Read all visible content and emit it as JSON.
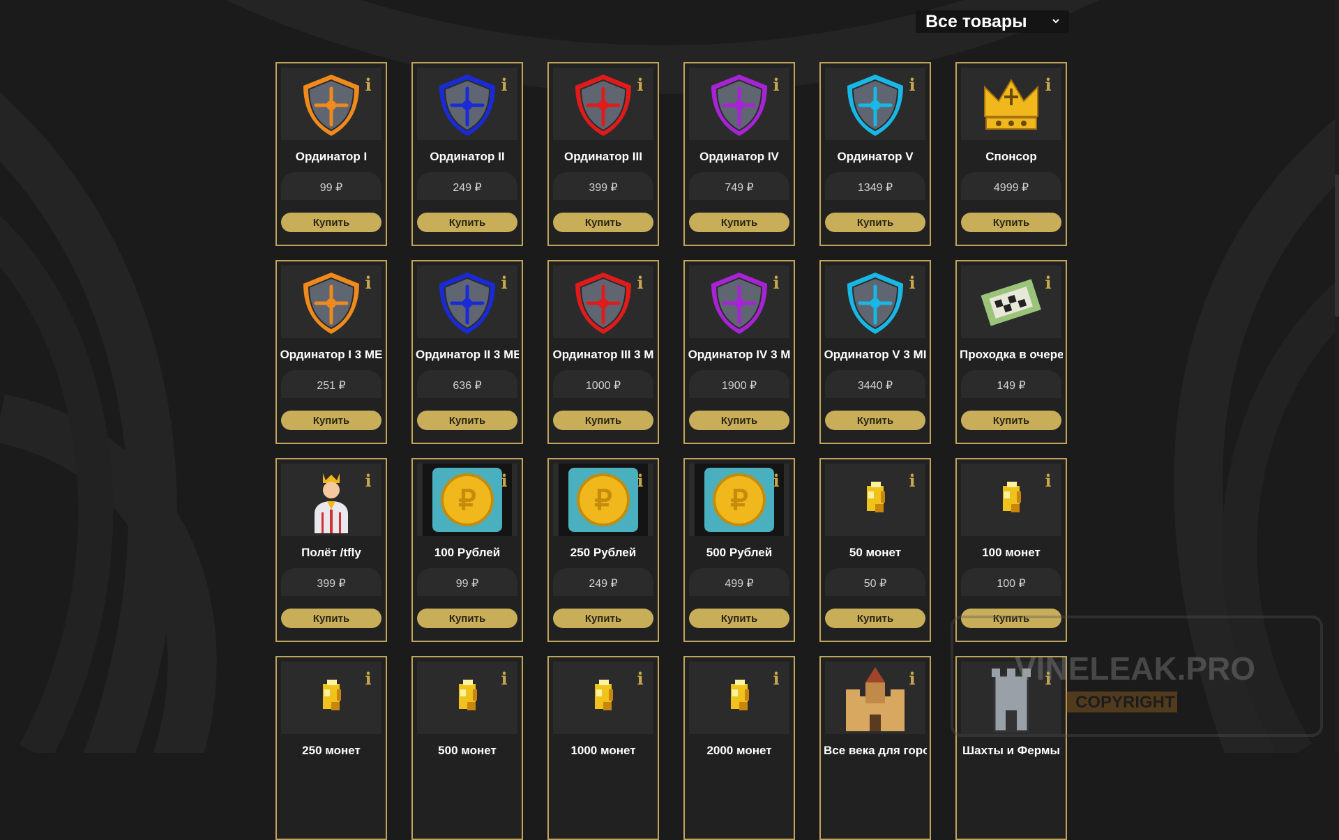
{
  "filter": {
    "selected": "Все товары"
  },
  "colors": {
    "accent": "#c9ae5a",
    "border": "#bfa45a",
    "background": "#1b1b1c",
    "card": "#212121"
  },
  "watermark": {
    "text": "VINELEAK.PRO",
    "subtext": "COPYRIGHT"
  },
  "products": [
    {
      "name": "Ординатор I",
      "price": "99 ₽",
      "buy": "Купить",
      "icon": "shield-orange-icon",
      "color": "#f08a1c"
    },
    {
      "name": "Ординатор II",
      "price": "249 ₽",
      "buy": "Купить",
      "icon": "shield-blue-icon",
      "color": "#1a2bd6"
    },
    {
      "name": "Ординатор III",
      "price": "399 ₽",
      "buy": "Купить",
      "icon": "shield-red-icon",
      "color": "#e01b1b"
    },
    {
      "name": "Ординатор IV",
      "price": "749 ₽",
      "buy": "Купить",
      "icon": "shield-purple-icon",
      "color": "#a624d4"
    },
    {
      "name": "Ординатор V",
      "price": "1349 ₽",
      "buy": "Купить",
      "icon": "shield-cyan-icon",
      "color": "#18b8e6"
    },
    {
      "name": "Спонсор",
      "price": "4999 ₽",
      "buy": "Купить",
      "icon": "crown-icon",
      "color": "#f0b81c"
    },
    {
      "name": "Ординатор I 3 ME",
      "price": "251 ₽",
      "buy": "Купить",
      "icon": "shield-orange-icon",
      "color": "#f08a1c"
    },
    {
      "name": "Ординатор II 3 ME",
      "price": "636 ₽",
      "buy": "Купить",
      "icon": "shield-blue-icon",
      "color": "#1a2bd6"
    },
    {
      "name": "Ординатор III 3 M",
      "price": "1000 ₽",
      "buy": "Купить",
      "icon": "shield-red-icon",
      "color": "#e01b1b"
    },
    {
      "name": "Ординатор IV 3 M",
      "price": "1900 ₽",
      "buy": "Купить",
      "icon": "shield-purple-icon",
      "color": "#a624d4"
    },
    {
      "name": "Ординатор V 3 MI",
      "price": "3440 ₽",
      "buy": "Купить",
      "icon": "shield-cyan-icon",
      "color": "#18b8e6"
    },
    {
      "name": "Проходка в очере",
      "price": "149 ₽",
      "buy": "Купить",
      "icon": "ticket-icon",
      "color": "#9ac47a"
    },
    {
      "name": "Полёт /tfly",
      "price": "399 ₽",
      "buy": "Купить",
      "icon": "person-crown-icon",
      "color": "#f0b81c"
    },
    {
      "name": "100 Рублей",
      "price": "99 ₽",
      "buy": "Купить",
      "icon": "ruble-coin-icon",
      "color": "#f0b81c"
    },
    {
      "name": "250 Рублей",
      "price": "249 ₽",
      "buy": "Купить",
      "icon": "ruble-coin-icon",
      "color": "#f0b81c"
    },
    {
      "name": "500 Рублей",
      "price": "499 ₽",
      "buy": "Купить",
      "icon": "ruble-coin-icon",
      "color": "#f0b81c"
    },
    {
      "name": "50 монет",
      "price": "50 ₽",
      "buy": "Купить",
      "icon": "gold-nugget-icon",
      "color": "#f0c21c"
    },
    {
      "name": "100 монет",
      "price": "100 ₽",
      "buy": "Купить",
      "icon": "gold-nugget-icon",
      "color": "#f0c21c"
    },
    {
      "name": "250 монет",
      "price": "",
      "buy": "",
      "icon": "gold-nugget-icon",
      "color": "#f0c21c"
    },
    {
      "name": "500 монет",
      "price": "",
      "buy": "",
      "icon": "gold-nugget-icon",
      "color": "#f0c21c"
    },
    {
      "name": "1000 монет",
      "price": "",
      "buy": "",
      "icon": "gold-nugget-icon",
      "color": "#f0c21c"
    },
    {
      "name": "2000 монет",
      "price": "",
      "buy": "",
      "icon": "gold-nugget-icon",
      "color": "#f0c21c"
    },
    {
      "name": "Все века для горо",
      "price": "",
      "buy": "",
      "icon": "castle-icon",
      "color": "#d9a860"
    },
    {
      "name": "Шахты и Фермы",
      "price": "",
      "buy": "",
      "icon": "tower-icon",
      "color": "#9aa0a8"
    }
  ]
}
